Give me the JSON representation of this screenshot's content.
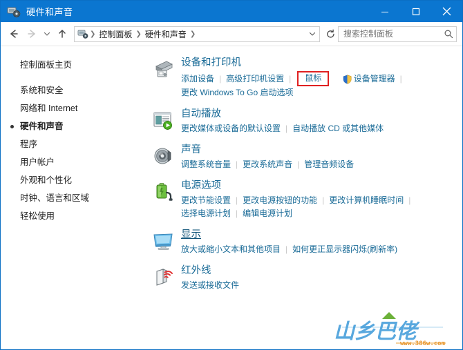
{
  "window": {
    "title": "硬件和声音",
    "icon": "hardware-sound-icon",
    "minimize_label": "最小化",
    "maximize_label": "最大化",
    "close_label": "关闭",
    "accent_color": "#0b76d0",
    "title_color": "#ffffff"
  },
  "navbar": {
    "back_label": "后退",
    "forward_label": "前进",
    "recent_label": "最近浏览的位置",
    "up_label": "向上",
    "breadcrumb": [
      "控制面板",
      "硬件和声音"
    ],
    "breadcrumb_dropdown": "历史记录",
    "refresh_label": "刷新",
    "search": {
      "placeholder": "搜索控制面板",
      "value": "",
      "icon": "search-icon"
    }
  },
  "sidebar": {
    "home": "控制面板主页",
    "items": [
      {
        "label": "系统和安全",
        "current": false
      },
      {
        "label": "网络和 Internet",
        "current": false
      },
      {
        "label": "硬件和声音",
        "current": true
      },
      {
        "label": "程序",
        "current": false
      },
      {
        "label": "用户帐户",
        "current": false
      },
      {
        "label": "外观和个性化",
        "current": false
      },
      {
        "label": "时钟、语言和区域",
        "current": false
      },
      {
        "label": "轻松使用",
        "current": false
      }
    ]
  },
  "main": {
    "sections": [
      {
        "icon": "printer-icon",
        "title": "设备和打印机",
        "title_hover": false,
        "rows": [
          [
            {
              "label": "添加设备",
              "shield": false,
              "highlight": false
            },
            {
              "label": "高级打印机设置",
              "shield": false,
              "highlight": false
            },
            {
              "label": "鼠标",
              "shield": false,
              "highlight": true
            },
            {
              "label": "设备管理器",
              "shield": true,
              "highlight": false
            }
          ],
          [
            {
              "label": "更改 Windows To Go 启动选项",
              "shield": false,
              "highlight": false
            }
          ]
        ]
      },
      {
        "icon": "autoplay-icon",
        "title": "自动播放",
        "title_hover": false,
        "rows": [
          [
            {
              "label": "更改媒体或设备的默认设置",
              "shield": false,
              "highlight": false
            },
            {
              "label": "自动播放 CD 或其他媒体",
              "shield": false,
              "highlight": false
            }
          ]
        ]
      },
      {
        "icon": "speaker-icon",
        "title": "声音",
        "title_hover": false,
        "rows": [
          [
            {
              "label": "调整系统音量",
              "shield": false,
              "highlight": false
            },
            {
              "label": "更改系统声音",
              "shield": false,
              "highlight": false
            },
            {
              "label": "管理音频设备",
              "shield": false,
              "highlight": false
            }
          ]
        ]
      },
      {
        "icon": "battery-icon",
        "title": "电源选项",
        "title_hover": false,
        "rows": [
          [
            {
              "label": "更改节能设置",
              "shield": false,
              "highlight": false
            },
            {
              "label": "更改电源按钮的功能",
              "shield": false,
              "highlight": false
            },
            {
              "label": "更改计算机睡眠时间",
              "shield": false,
              "highlight": false
            }
          ],
          [
            {
              "label": "选择电源计划",
              "shield": false,
              "highlight": false
            },
            {
              "label": "编辑电源计划",
              "shield": false,
              "highlight": false
            }
          ]
        ]
      },
      {
        "icon": "monitor-icon",
        "title": "显示",
        "title_hover": true,
        "rows": [
          [
            {
              "label": "放大或缩小文本和其他项目",
              "shield": false,
              "highlight": false
            },
            {
              "label": "如何更正显示器闪烁(刷新率)",
              "shield": false,
              "highlight": false
            }
          ]
        ]
      },
      {
        "icon": "infrared-icon",
        "title": "红外线",
        "title_hover": false,
        "rows": [
          [
            {
              "label": "发送或接收文件",
              "shield": false,
              "highlight": false
            }
          ]
        ]
      }
    ]
  },
  "watermark": {
    "brand": "山乡巴佬",
    "url": "www.386w.com"
  },
  "colors": {
    "link": "#1a6b97",
    "highlight_border": "#e02020",
    "titlebar": "#0b76d0"
  }
}
